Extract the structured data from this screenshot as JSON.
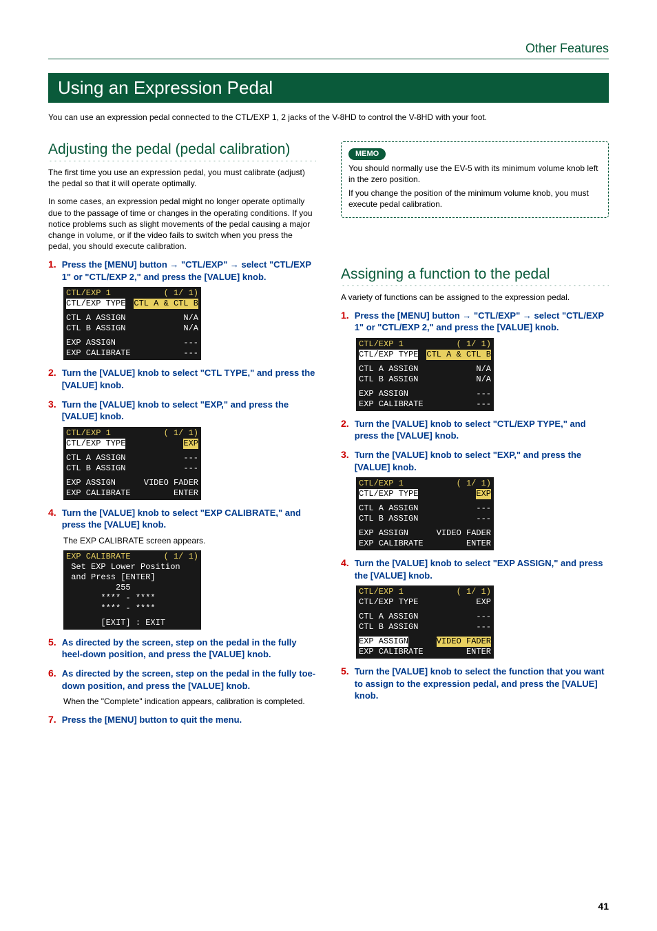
{
  "header": {
    "category": "Other Features"
  },
  "title": "Using an Expression Pedal",
  "intro": "You can use an expression pedal connected to the CTL/EXP 1, 2 jacks of the V-8HD to control the V-8HD with your foot.",
  "left": {
    "heading": "Adjusting the pedal (pedal calibration)",
    "p1": "The first time you use an expression pedal, you must calibrate (adjust) the pedal so that it will operate optimally.",
    "p2": "In some cases, an expression pedal might no longer operate optimally due to the passage of time or changes in the operating conditions. If you notice problems such as slight movements of the pedal causing a major change in volume, or if the video fails to switch when you press the pedal, you should execute calibration.",
    "s1": "Press the [MENU] button → \"CTL/EXP\" → select \"CTL/EXP 1\" or \"CTL/EXP 2,\" and press the [VALUE] knob.",
    "s2": "Turn the [VALUE] knob to select \"CTL TYPE,\" and press the [VALUE] knob.",
    "s3": "Turn the [VALUE] knob to select \"EXP,\" and press the [VALUE] knob.",
    "s4": "Turn the [VALUE] knob to select \"EXP CALIBRATE,\" and press the [VALUE] knob.",
    "s4note": "The EXP CALIBRATE screen appears.",
    "s5": "As directed by the screen, step on the pedal in the fully heel-down position, and press the [VALUE] knob.",
    "s6": "As directed by the screen, step on the pedal in the fully toe-down position, and press the [VALUE] knob.",
    "s6note": "When the \"Complete\" indication appears, calibration is completed.",
    "s7": "Press the [MENU] button to quit the menu.",
    "lcd1": {
      "title": "CTL/EXP 1",
      "page": "( 1/ 1)",
      "r1a": "CTL/EXP TYPE",
      "r1b": "CTL A & CTL B",
      "r2a": "CTL A ASSIGN",
      "r2b": "N/A",
      "r3a": "CTL B ASSIGN",
      "r3b": "N/A",
      "r4a": "EXP ASSIGN",
      "r4b": "---",
      "r5a": "EXP CALIBRATE",
      "r5b": "---"
    },
    "lcd2": {
      "title": "CTL/EXP 1",
      "page": "( 1/ 1)",
      "r1a": "CTL/EXP TYPE",
      "r1b": "EXP",
      "r2a": "CTL A ASSIGN",
      "r2b": "---",
      "r3a": "CTL B ASSIGN",
      "r3b": "---",
      "r4a": "EXP ASSIGN",
      "r4b": "VIDEO FADER",
      "r5a": "EXP CALIBRATE",
      "r5b": "ENTER"
    },
    "lcd3": {
      "title": "EXP CALIBRATE",
      "page": "( 1/ 1)",
      "l1": " Set EXP Lower Position",
      "l2": " and Press [ENTER]",
      "l3": "          255",
      "l4": "       **** - ****",
      "l5": "       **** - ****",
      "l6": "       [EXIT] : EXIT"
    }
  },
  "right": {
    "memo_label": "MEMO",
    "memo_p1": "You should normally use the EV-5 with its minimum volume knob left in the zero position.",
    "memo_p2": "If you change the position of the minimum volume knob, you must execute pedal calibration.",
    "heading": "Assigning a function to the pedal",
    "p1": "A variety of functions can be assigned to the expression pedal.",
    "s1": "Press the [MENU] button → \"CTL/EXP\" → select \"CTL/EXP 1\" or \"CTL/EXP 2,\" and press the [VALUE] knob.",
    "s2": "Turn the [VALUE] knob to select \"CTL/EXP TYPE,\" and press the [VALUE] knob.",
    "s3": "Turn the [VALUE] knob to select \"EXP,\" and press the [VALUE] knob.",
    "s4": "Turn the [VALUE] knob to select \"EXP ASSIGN,\" and press the [VALUE] knob.",
    "s5": "Turn the [VALUE] knob to select the function that you want to assign to the expression pedal, and press the [VALUE] knob.",
    "lcd1": {
      "title": "CTL/EXP 1",
      "page": "( 1/ 1)",
      "r1a": "CTL/EXP TYPE",
      "r1b": "CTL A & CTL B",
      "r2a": "CTL A ASSIGN",
      "r2b": "N/A",
      "r3a": "CTL B ASSIGN",
      "r3b": "N/A",
      "r4a": "EXP ASSIGN",
      "r4b": "---",
      "r5a": "EXP CALIBRATE",
      "r5b": "---"
    },
    "lcd2": {
      "title": "CTL/EXP 1",
      "page": "( 1/ 1)",
      "r1a": "CTL/EXP TYPE",
      "r1b": "EXP",
      "r2a": "CTL A ASSIGN",
      "r2b": "---",
      "r3a": "CTL B ASSIGN",
      "r3b": "---",
      "r4a": "EXP ASSIGN",
      "r4b": "VIDEO FADER",
      "r5a": "EXP CALIBRATE",
      "r5b": "ENTER"
    },
    "lcd3": {
      "title": "CTL/EXP 1",
      "page": "( 1/ 1)",
      "r1a": "CTL/EXP TYPE",
      "r1b": "EXP",
      "r2a": "CTL A ASSIGN",
      "r2b": "---",
      "r3a": "CTL B ASSIGN",
      "r3b": "---",
      "r4a": "EXP ASSIGN",
      "r4b": "VIDEO FADER",
      "r5a": "EXP CALIBRATE",
      "r5b": "ENTER"
    }
  },
  "page_number": "41"
}
